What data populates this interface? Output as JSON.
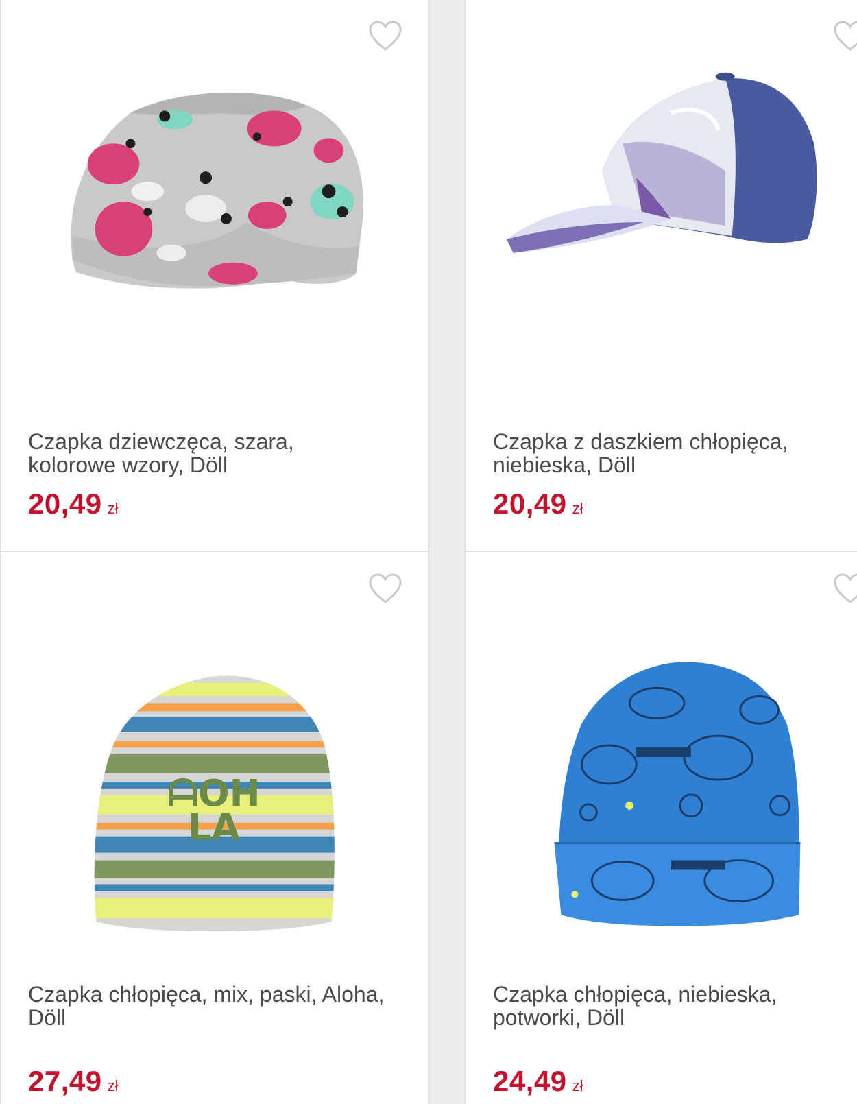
{
  "products": [
    {
      "name": "Czapka dziewczęca, szara, kolorowe wzory, Döll",
      "price": "20,49",
      "currency": "zł",
      "image": "grey-slouch-beanie-pink-pattern",
      "wishlist_icon": "heart-outline-icon"
    },
    {
      "name": "Czapka z daszkiem chłopięca, niebieska, Döll",
      "price": "20,49",
      "currency": "zł",
      "image": "blue-baseball-cap-photo-print",
      "wishlist_icon": "heart-outline-icon"
    },
    {
      "name": "Czapka chłopięca, mix, paski, Aloha, Döll",
      "price": "27,49",
      "currency": "zł",
      "image": "striped-beanie-aloha",
      "wishlist_icon": "heart-outline-icon"
    },
    {
      "name": "Czapka chłopięca, niebieska, potworki, Döll",
      "price": "24,49",
      "currency": "zł",
      "image": "blue-beanie-monsters",
      "wishlist_icon": "heart-outline-icon"
    }
  ],
  "colors": {
    "price": "#c4122e",
    "name": "#4a4a4a",
    "heart": "#c9c9c9",
    "background": "#ebebeb"
  }
}
